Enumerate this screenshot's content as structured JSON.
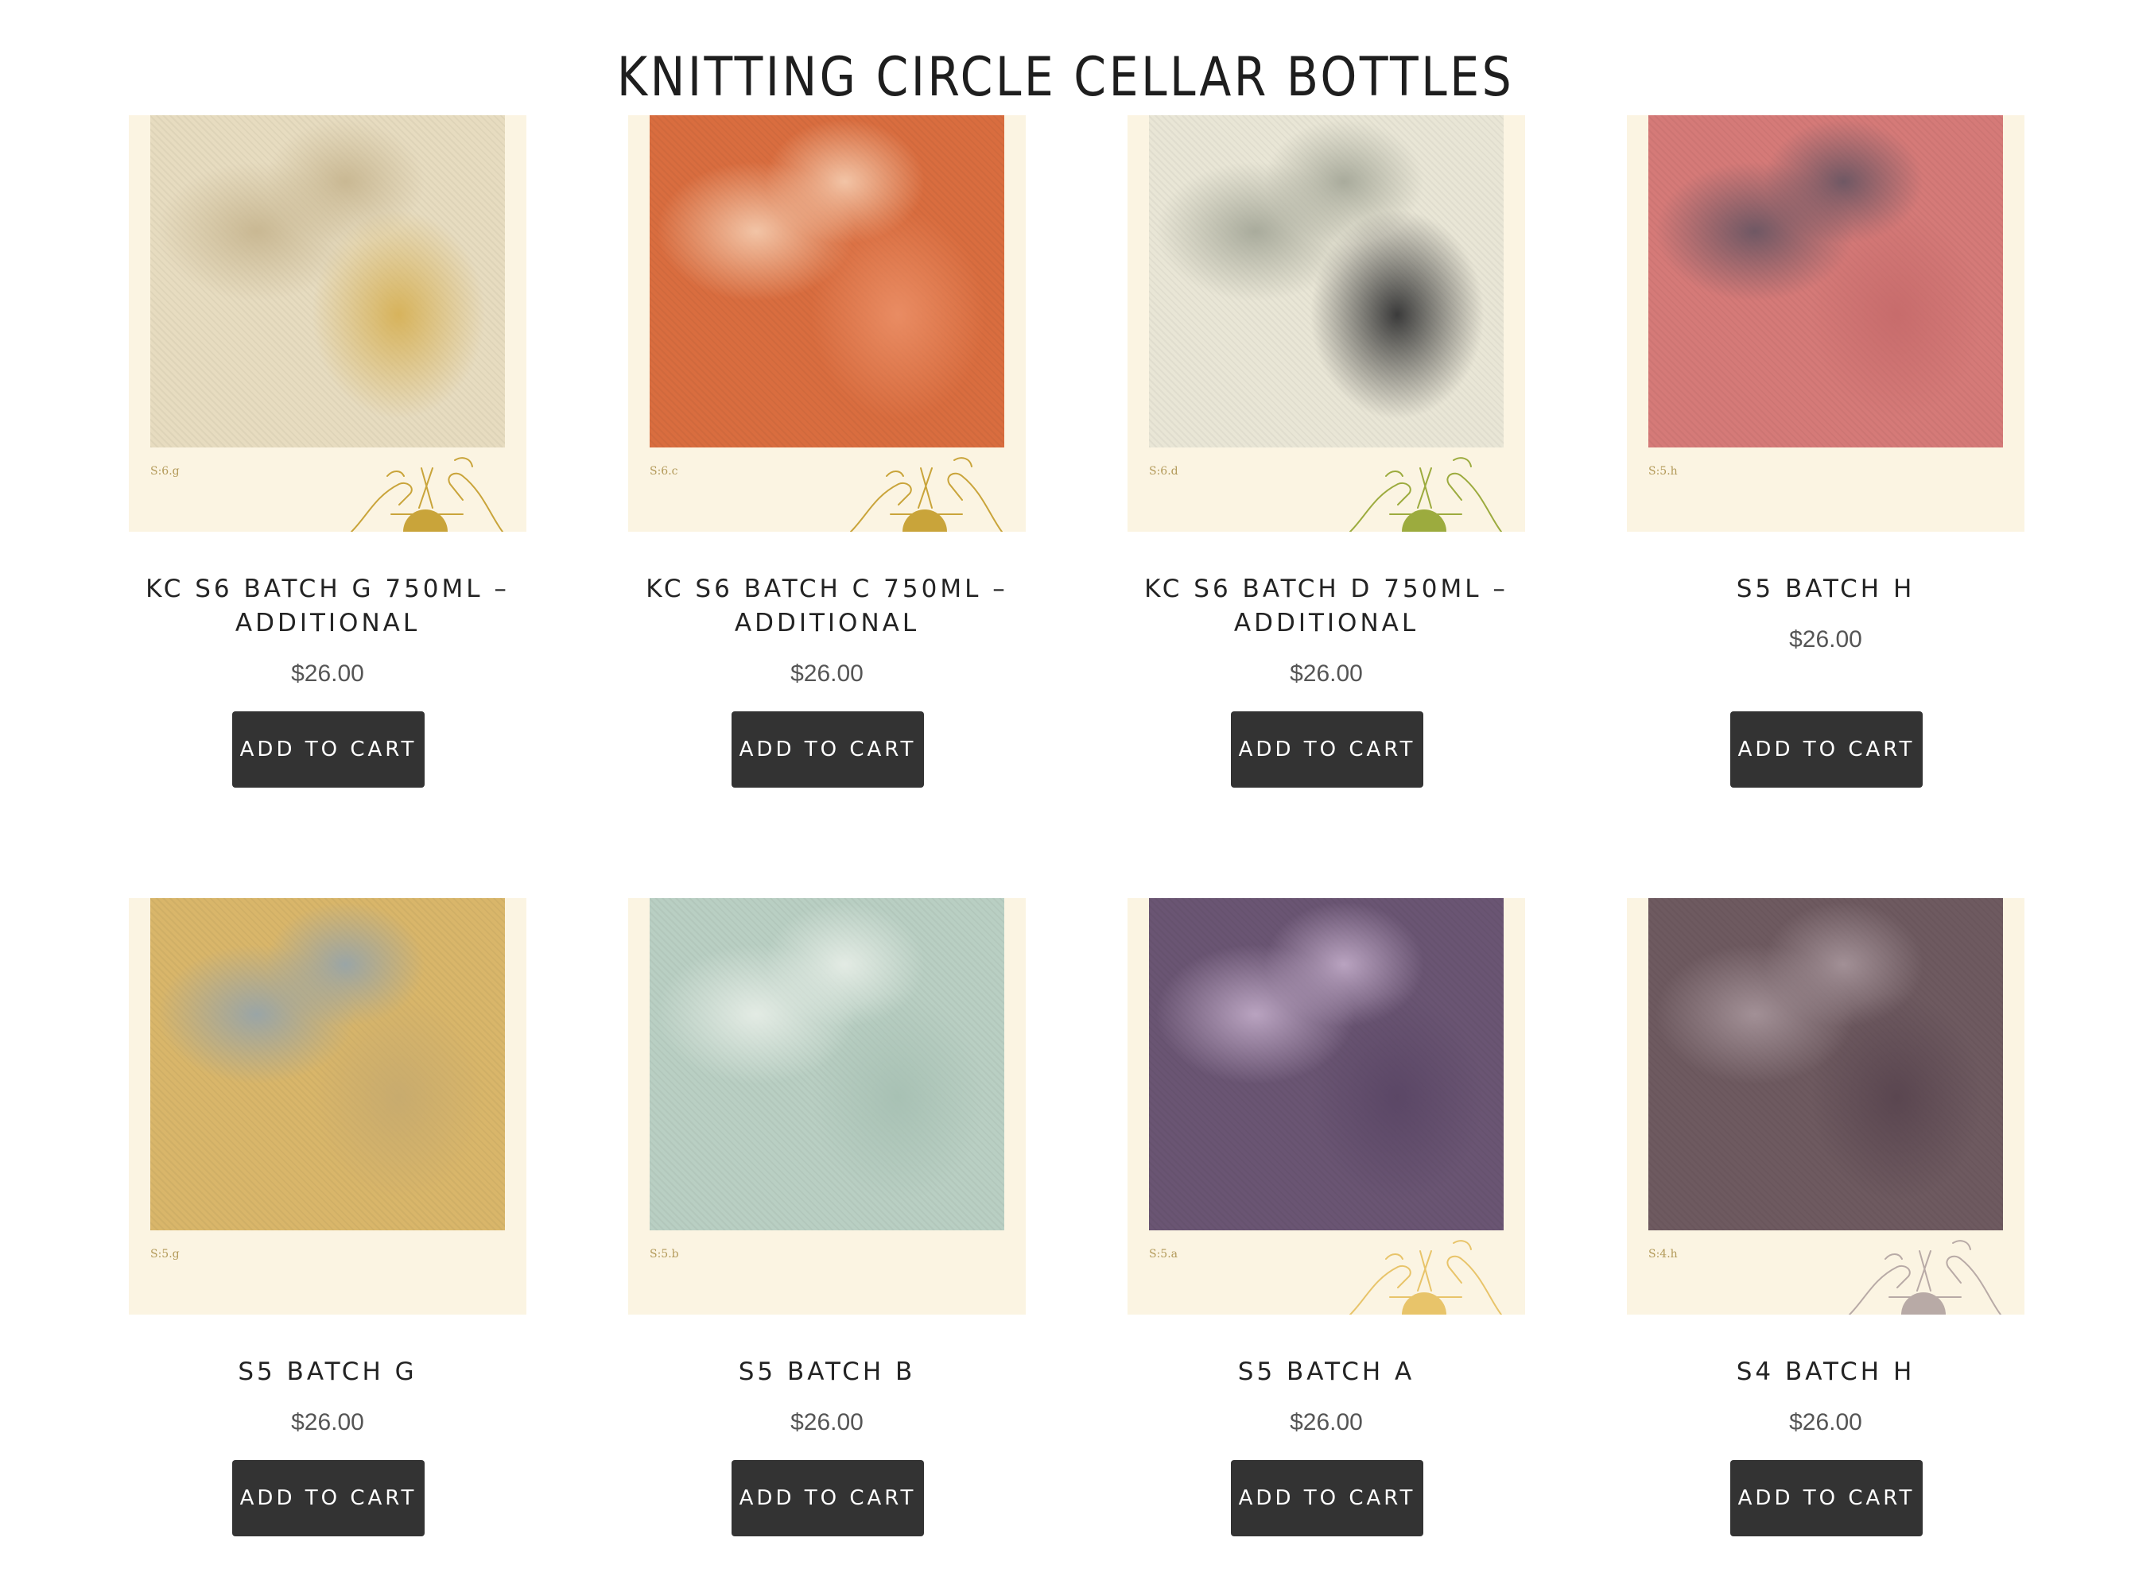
{
  "page": {
    "title": "KNITTING CIRCLE CELLAR BOTTLES"
  },
  "colors": {
    "button_bg": "#333333",
    "button_text": "#ffffff",
    "card_bg": "#fbf4e2"
  },
  "products": [
    {
      "name": "KC S6 BATCH G 750ML – ADDITIONAL",
      "price": "$26.00",
      "button": "ADD TO CART",
      "image_code": "S:6.g",
      "swatch_colors": [
        "#e7dcc0",
        "#c9b893",
        "#d7b35c"
      ],
      "emblem_color": "#c9a43a"
    },
    {
      "name": "KC S6 BATCH C 750ML – ADDITIONAL",
      "price": "$26.00",
      "button": "ADD TO CART",
      "image_code": "S:6.c",
      "swatch_colors": [
        "#d96d3f",
        "#f2c4a6",
        "#e98c63"
      ],
      "emblem_color": "#c9a43a"
    },
    {
      "name": "KC S6 BATCH D 750ML – ADDITIONAL",
      "price": "$26.00",
      "button": "ADD TO CART",
      "image_code": "S:6.d",
      "swatch_colors": [
        "#e9e6d6",
        "#a9ab9c",
        "#3b3b3b"
      ],
      "emblem_color": "#9cab3e"
    },
    {
      "name": "S5 BATCH H",
      "price": "$26.00",
      "button": "ADD TO CART",
      "image_code": "S:5.h",
      "swatch_colors": [
        "#d57a78",
        "#6f5864",
        "#c76c6c"
      ],
      "emblem_color": ""
    },
    {
      "name": "S5 BATCH G",
      "price": "$26.00",
      "button": "ADD TO CART",
      "image_code": "S:5.g",
      "swatch_colors": [
        "#d9b66a",
        "#9aa5a6",
        "#c8ab6e"
      ],
      "emblem_color": ""
    },
    {
      "name": "S5 BATCH B",
      "price": "$26.00",
      "button": "ADD TO CART",
      "image_code": "S:5.b",
      "swatch_colors": [
        "#b9cfc3",
        "#e3ebe4",
        "#a8c1b4"
      ],
      "emblem_color": ""
    },
    {
      "name": "S5 BATCH A",
      "price": "$26.00",
      "button": "ADD TO CART",
      "image_code": "S:5.a",
      "swatch_colors": [
        "#6a5573",
        "#b9a3c0",
        "#5b4766"
      ],
      "emblem_color": "#e8c46a"
    },
    {
      "name": "S4 BATCH H",
      "price": "$26.00",
      "button": "ADD TO CART",
      "image_code": "S:4.h",
      "swatch_colors": [
        "#6e5a60",
        "#a29096",
        "#5a4650"
      ],
      "emblem_color": "#b8aaa6"
    }
  ]
}
